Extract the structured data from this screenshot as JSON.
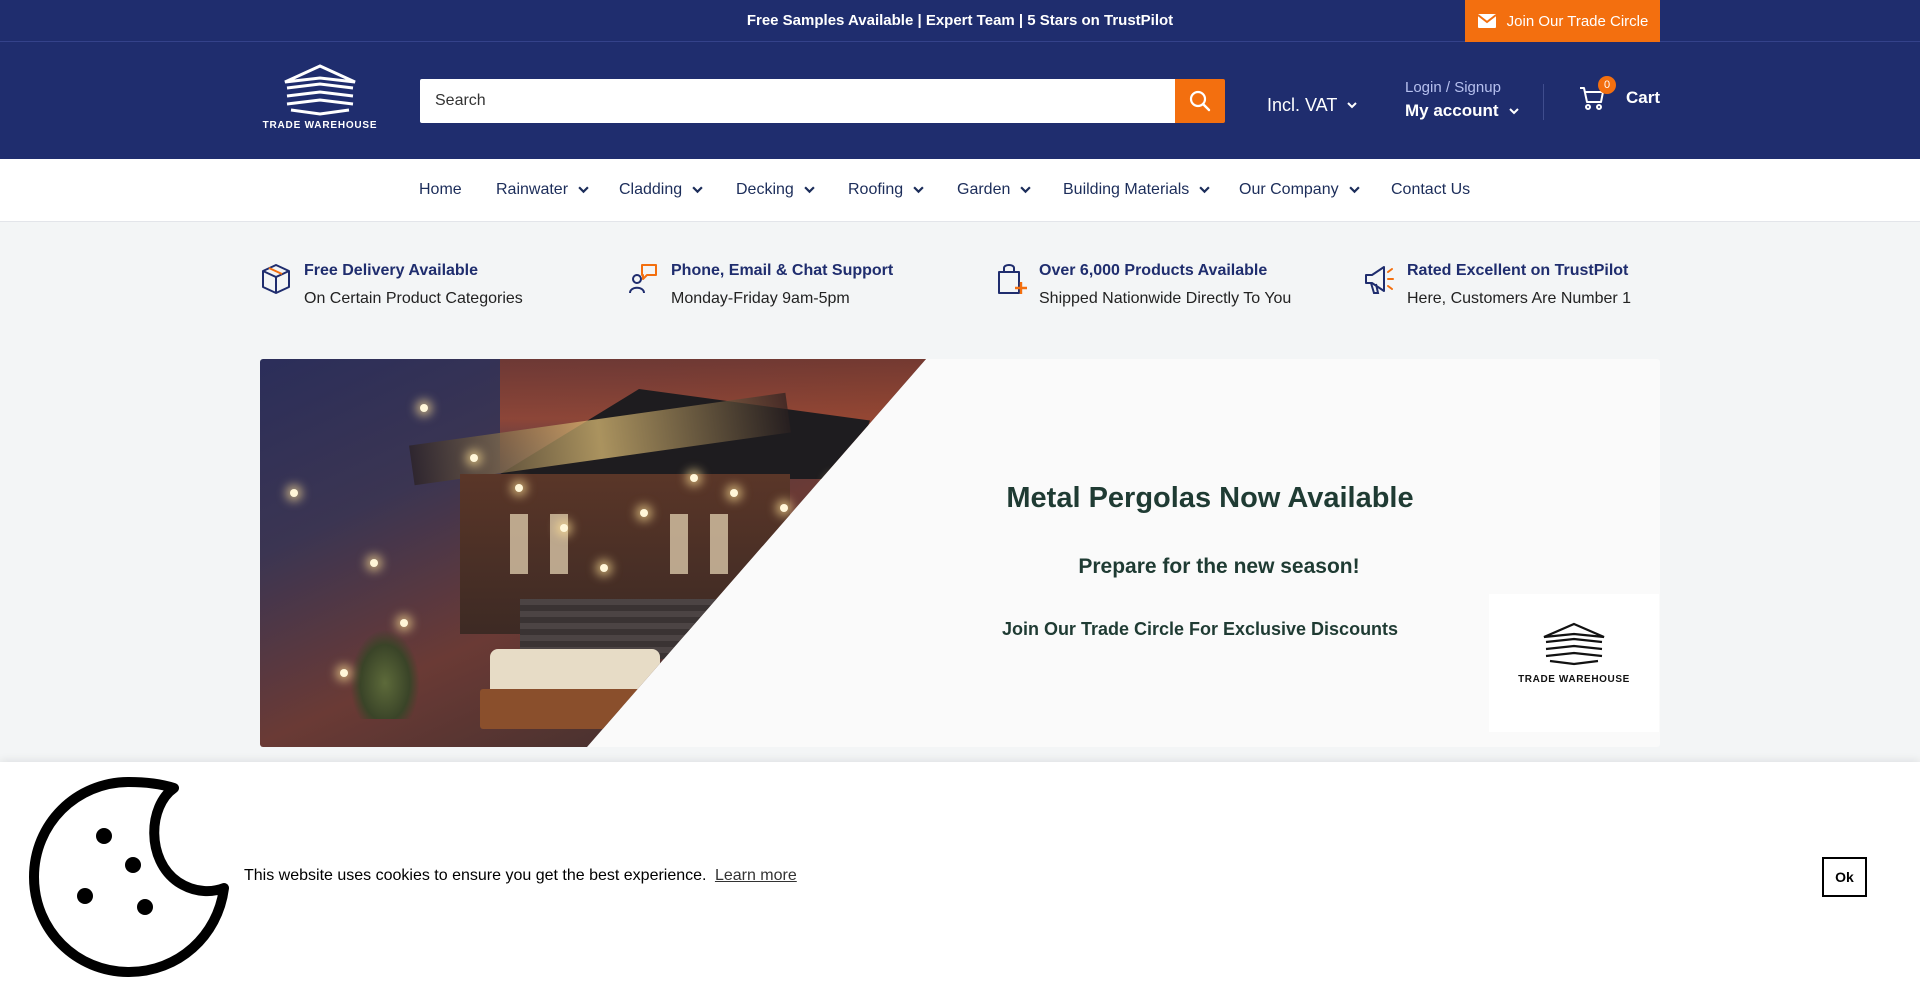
{
  "announcement": {
    "text": "Free Samples Available | Expert Team | 5 Stars on TrustPilot",
    "trade_button": "Join Our Trade Circle"
  },
  "header": {
    "logo_text": "TRADE WAREHOUSE",
    "search_placeholder": "Search",
    "vat_label": "Incl. VAT",
    "login_link": "Login / Signup",
    "my_account": "My account",
    "cart_count": "0",
    "cart_label": "Cart"
  },
  "nav": {
    "items": [
      {
        "label": "Home",
        "dropdown": false
      },
      {
        "label": "Rainwater",
        "dropdown": true
      },
      {
        "label": "Cladding",
        "dropdown": true
      },
      {
        "label": "Decking",
        "dropdown": true
      },
      {
        "label": "Roofing",
        "dropdown": true
      },
      {
        "label": "Garden",
        "dropdown": true
      },
      {
        "label": "Building Materials",
        "dropdown": true
      },
      {
        "label": "Our Company",
        "dropdown": true
      },
      {
        "label": "Contact Us",
        "dropdown": false
      }
    ]
  },
  "usps": [
    {
      "icon": "box-icon",
      "title": "Free Delivery Available",
      "subtitle": "On Certain Product Categories"
    },
    {
      "icon": "support-chat-icon",
      "title": "Phone, Email & Chat Support",
      "subtitle": "Monday-Friday 9am-5pm"
    },
    {
      "icon": "shopping-bag-icon",
      "title": "Over 6,000 Products Available",
      "subtitle": "Shipped Nationwide Directly To You"
    },
    {
      "icon": "megaphone-icon",
      "title": "Rated Excellent on TrustPilot",
      "subtitle": "Here, Customers Are Number 1"
    }
  ],
  "banner": {
    "title": "Metal Pergolas Now Available",
    "subtitle": "Prepare for the new season!",
    "cta": "Join Our Trade Circle For Exclusive Discounts",
    "logo_text": "TRADE WAREHOUSE"
  },
  "cookie": {
    "text": "This website uses cookies to ensure you get the best experience.",
    "link": "Learn more",
    "ok": "Ok"
  },
  "colors": {
    "navy": "#1f2d6e",
    "orange": "#f36f0f",
    "background": "#f3f5f6"
  }
}
